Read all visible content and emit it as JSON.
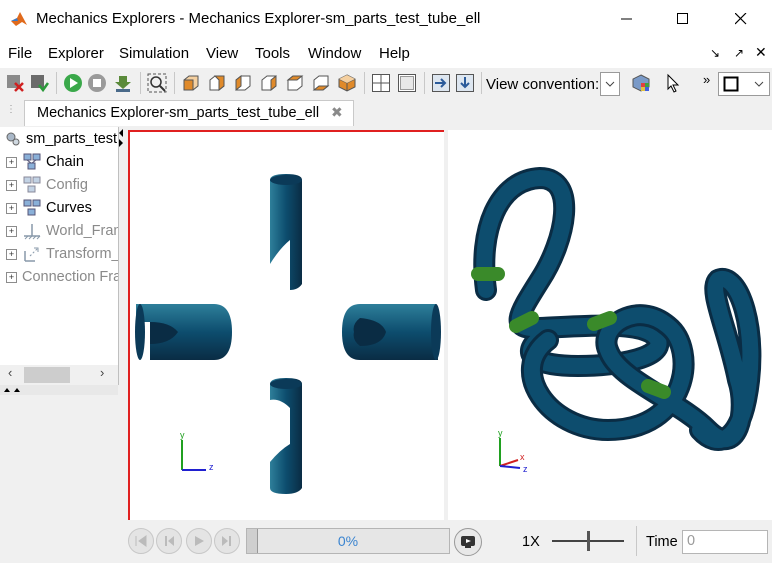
{
  "window": {
    "title": "Mechanics Explorers - Mechanics Explorer-sm_parts_test_tube_ell",
    "controls": [
      "minimize-icon",
      "maximize-icon",
      "close-icon"
    ]
  },
  "menubar": {
    "items": [
      "File",
      "Explorer",
      "Simulation",
      "View",
      "Tools",
      "Window",
      "Help"
    ]
  },
  "toolbar": {
    "view_convention_label": "View convention:",
    "icons": [
      "stop-sim-icon",
      "save-icon",
      "run-icon",
      "stop-icon",
      "step-icon",
      "fit-icon",
      "view-front-icon",
      "view-back-icon",
      "view-left-icon",
      "view-right-icon",
      "view-top-icon",
      "view-iso-icon",
      "layout-4-icon",
      "layout-1-icon",
      "import-icon",
      "export-icon",
      "color-icon",
      "pointer-icon"
    ]
  },
  "document_tab": {
    "label": "Mechanics Explorer-sm_parts_test_tube_ell"
  },
  "tree": {
    "root": "sm_parts_test",
    "items": [
      {
        "label": "Chain",
        "grayed": false
      },
      {
        "label": "Config",
        "grayed": true
      },
      {
        "label": "Curves",
        "grayed": false
      },
      {
        "label": "World_Frame",
        "grayed": true
      },
      {
        "label": "Transform_",
        "grayed": true
      },
      {
        "label": "Connection Frames",
        "grayed": true
      }
    ]
  },
  "viewports": {
    "left": {
      "axes": [
        "y",
        "z"
      ]
    },
    "right": {
      "axes": [
        "y",
        "x",
        "z"
      ]
    }
  },
  "playback": {
    "progress_label": "0%",
    "progress": 0,
    "speed_label": "1X",
    "time_label": "Time",
    "time_value": "0"
  },
  "colors": {
    "tube": "#0d4d6e",
    "tube_highlight": "#2e8a9e",
    "marker": "#3a8a2a",
    "selection_border": "#e02020"
  }
}
